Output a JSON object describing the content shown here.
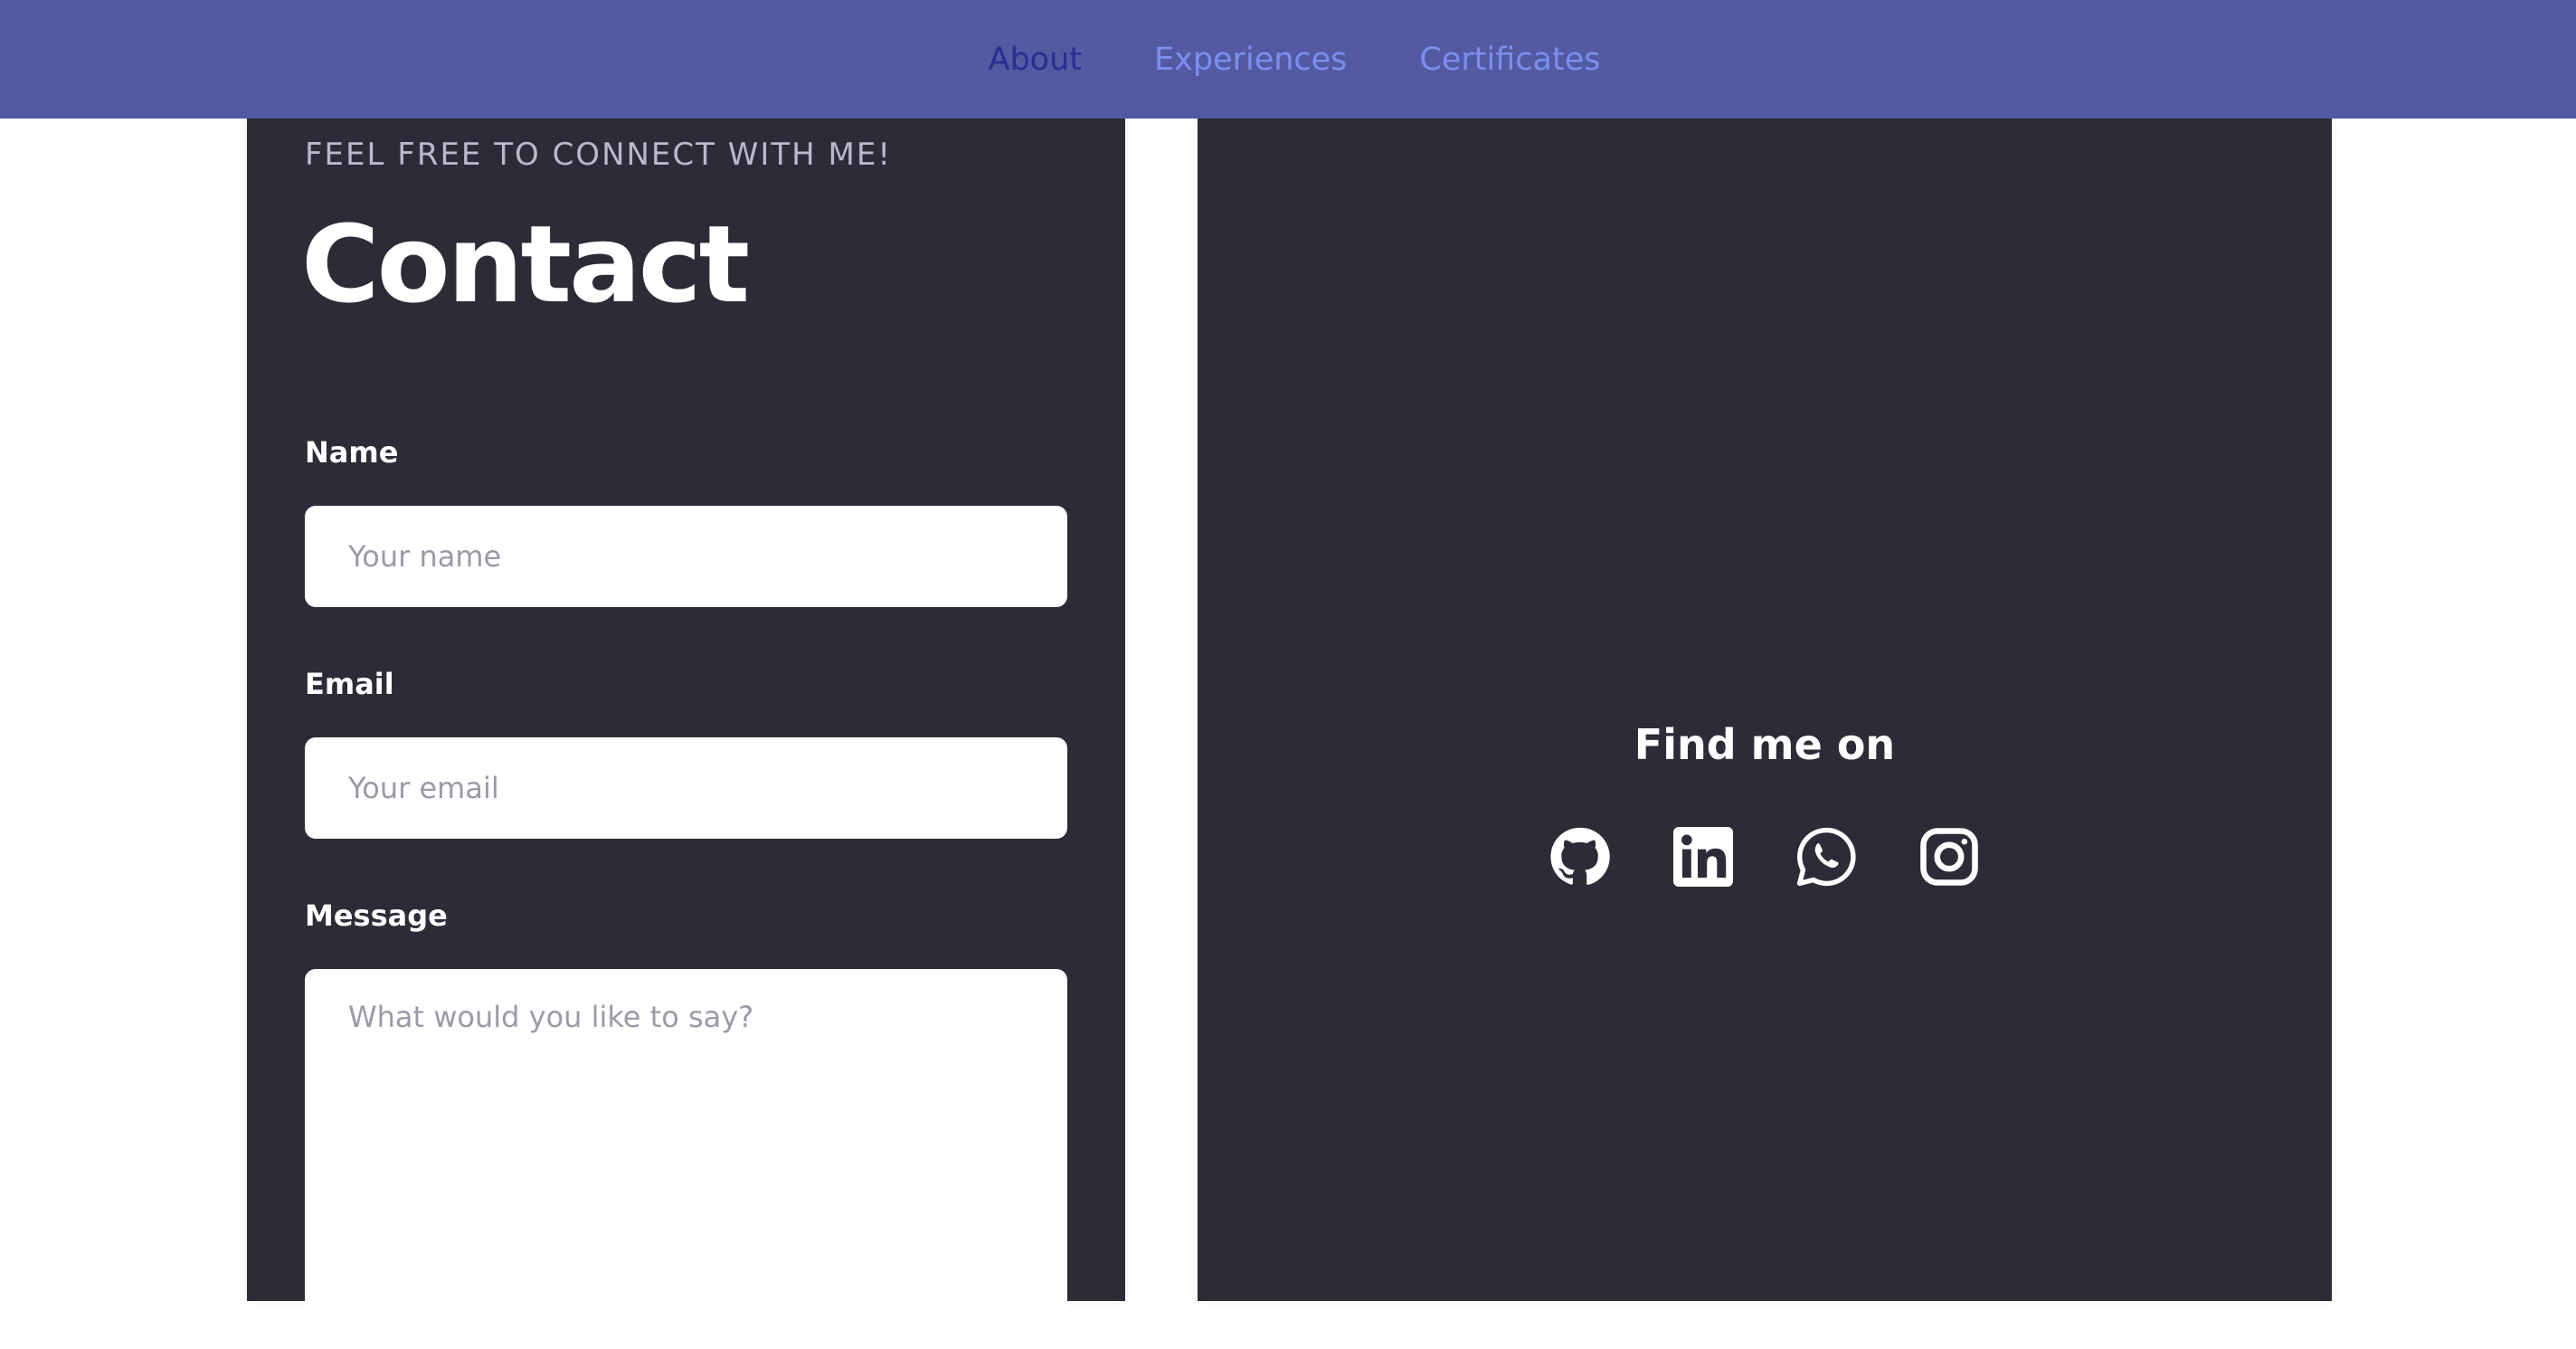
{
  "nav": {
    "items": [
      {
        "label": "About",
        "active": true
      },
      {
        "label": "Experiences",
        "active": false
      },
      {
        "label": "Certificates",
        "active": false
      }
    ]
  },
  "contact": {
    "eyebrow": "FEEL FREE TO CONNECT WITH ME!",
    "title": "Contact",
    "name_label": "Name",
    "name_placeholder": "Your name",
    "name_value": "",
    "email_label": "Email",
    "email_placeholder": "Your email",
    "email_value": "",
    "message_label": "Message",
    "message_placeholder": "What would you like to say?",
    "message_value": ""
  },
  "social": {
    "title": "Find me on",
    "icons": [
      "github-icon",
      "linkedin-icon",
      "whatsapp-icon",
      "instagram-icon"
    ]
  },
  "colors": {
    "topbar": "#535aa2",
    "nav_active": "#272f8f",
    "nav_link": "#7b8ff0",
    "card": "#2c2b37"
  }
}
